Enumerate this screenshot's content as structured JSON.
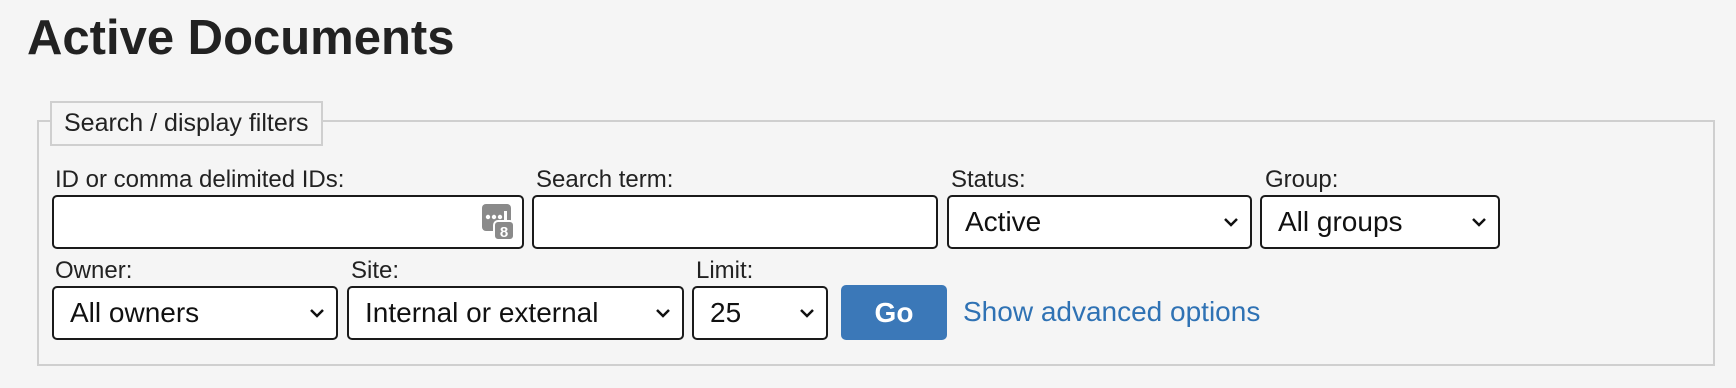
{
  "page": {
    "title": "Active Documents"
  },
  "filters": {
    "legend": "Search / display filters",
    "ids": {
      "label": "ID or comma delimited IDs:",
      "value": ""
    },
    "search": {
      "label": "Search term:",
      "value": ""
    },
    "status": {
      "label": "Status:",
      "selected": "Active"
    },
    "group": {
      "label": "Group:",
      "selected": "All groups"
    },
    "owner": {
      "label": "Owner:",
      "selected": "All owners"
    },
    "site": {
      "label": "Site:",
      "selected": "Internal or external"
    },
    "limit": {
      "label": "Limit:",
      "selected": "25"
    },
    "go_label": "Go",
    "advanced_link": "Show advanced options"
  },
  "colors": {
    "button": "#3b78b8",
    "link": "#2f72b4"
  },
  "icons": {
    "ids_field": "password-manager-keypad-icon",
    "select": "chevron-down-icon"
  }
}
